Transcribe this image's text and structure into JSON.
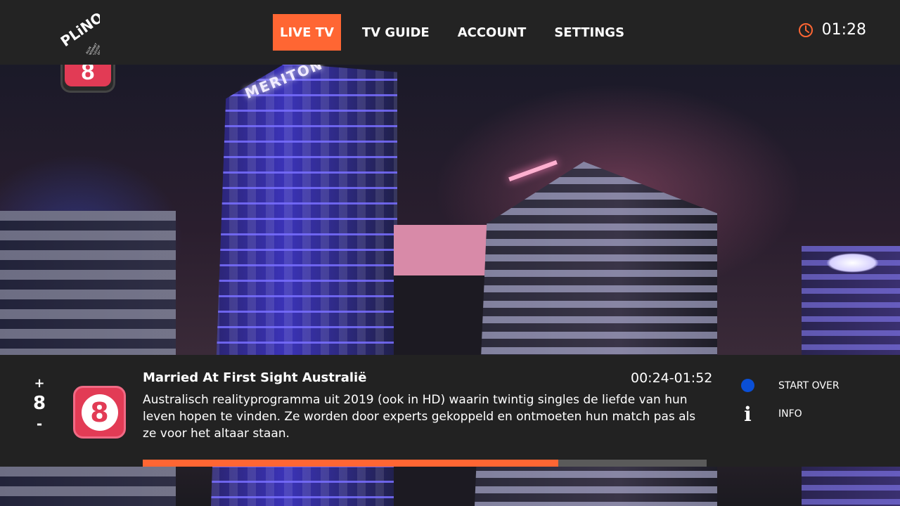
{
  "nav": {
    "items": [
      {
        "label": "LIVE TV",
        "active": true
      },
      {
        "label": "TV GUIDE",
        "active": false
      },
      {
        "label": "ACCOUNT",
        "active": false
      },
      {
        "label": "SETTINGS",
        "active": false
      }
    ]
  },
  "brand": {
    "logo_text": "PLiNQ",
    "tagline_lines": [
      "ALLIN",
      "INTERNET",
      "TELEVISIE",
      "TELEFONIE"
    ]
  },
  "clock": {
    "icon": "clock-icon",
    "time": "01:28"
  },
  "background": {
    "sign_text": "MERITON"
  },
  "channel": {
    "plus": "+",
    "number": "8",
    "minus": "-",
    "logo_text": "8",
    "logo_prefix": "rtl",
    "logo_color": "#e23b55"
  },
  "program": {
    "title": "Married At First Sight Australië",
    "time_range": "00:24-01:52",
    "description": "Australisch realityprogramma uit 2019 (ook in HD) waarin twintig singles de liefde van hun leven hopen te vinden. Ze worden door experts gekoppeld en ontmoeten hun match pas als ze voor het altaar staan.",
    "progress": 0.737
  },
  "actions": {
    "start_over": {
      "label": "START OVER",
      "icon": "blue-dot-icon",
      "color": "#0a4fd6"
    },
    "info": {
      "label": "INFO",
      "icon": "info-icon"
    }
  },
  "colors": {
    "accent": "#ff6633",
    "panel_bg": "#222222",
    "topbar_bg": "#232323"
  }
}
